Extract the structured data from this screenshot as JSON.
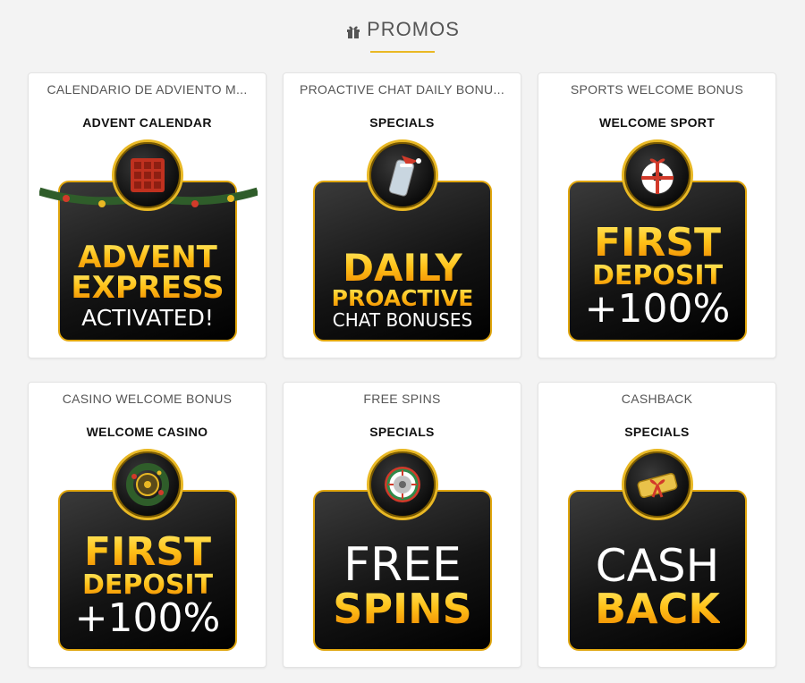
{
  "header": {
    "title": "PROMOS",
    "icon": "gift-icon"
  },
  "colors": {
    "accent": "#e9b824",
    "background": "#f3f3f3",
    "card": "#ffffff",
    "banner": "#111111"
  },
  "promos": [
    {
      "title": "CALENDARIO DE ADVIENTO M...",
      "category": "ADVENT CALENDAR",
      "icon": "advent-calendar-icon",
      "banner_lines": [
        "ADVENT",
        "EXPRESS",
        "ACTIVATED!"
      ]
    },
    {
      "title": "PROACTIVE CHAT DAILY BONU...",
      "category": "SPECIALS",
      "icon": "phone-santa-hat-icon",
      "banner_lines": [
        "DAILY",
        "PROACTIVE",
        "CHAT BONUSES"
      ]
    },
    {
      "title": "SPORTS WELCOME BONUS",
      "category": "WELCOME SPORT",
      "icon": "soccer-ball-gift-icon",
      "banner_lines": [
        "FIRST",
        "DEPOSIT",
        "+100%"
      ]
    },
    {
      "title": "CASINO WELCOME BONUS",
      "category": "WELCOME CASINO",
      "icon": "roulette-wreath-icon",
      "banner_lines": [
        "FIRST",
        "DEPOSIT",
        "+100%"
      ]
    },
    {
      "title": "FREE SPINS",
      "category": "SPECIALS",
      "icon": "roulette-wheel-icon",
      "banner_lines": [
        "FREE",
        "SPINS"
      ]
    },
    {
      "title": "CASHBACK",
      "category": "SPECIALS",
      "icon": "gold-gift-bow-icon",
      "banner_lines": [
        "CASH",
        "BACK"
      ]
    }
  ]
}
